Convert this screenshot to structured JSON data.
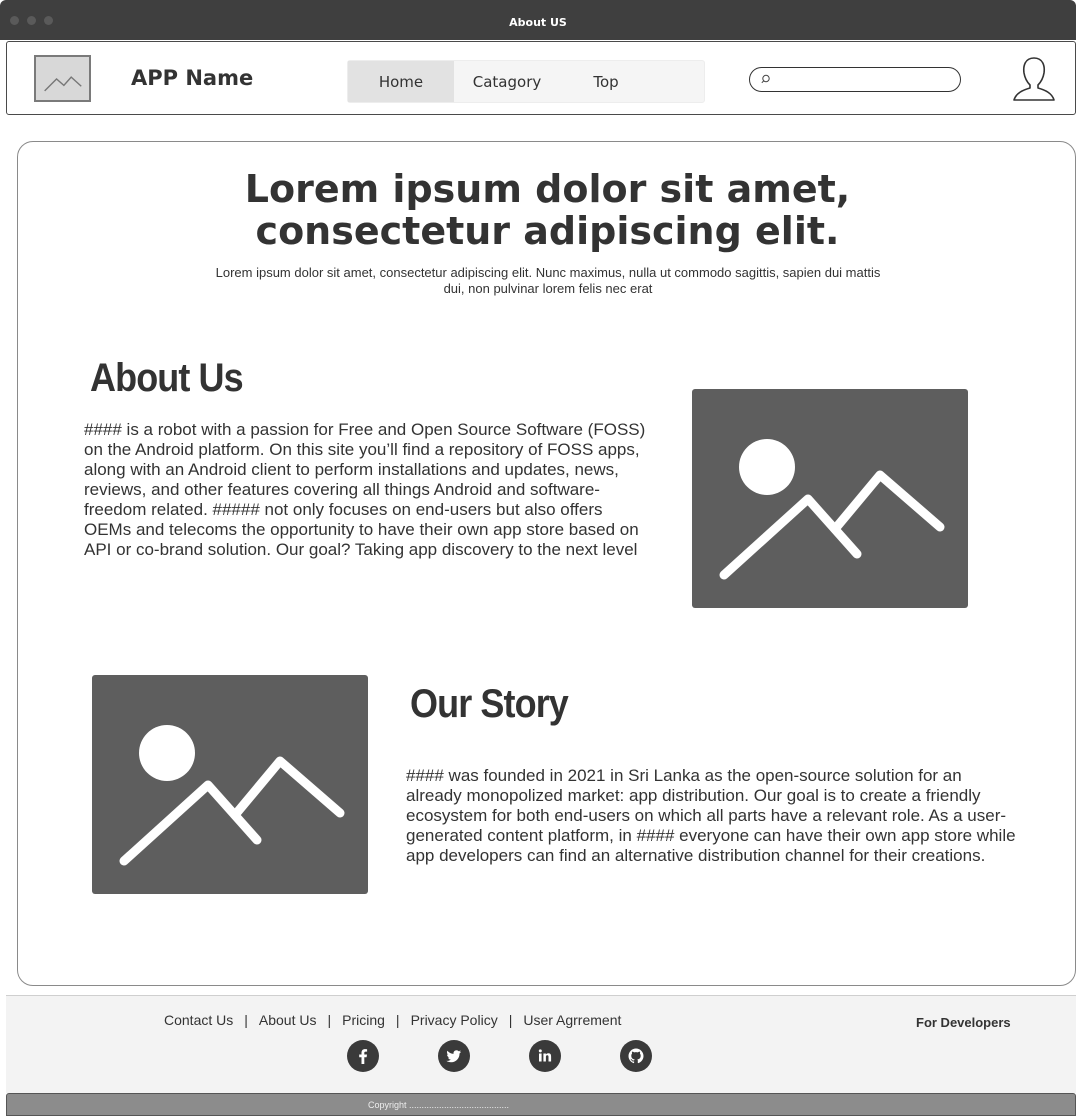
{
  "window": {
    "title": "About US"
  },
  "header": {
    "app_name": "APP Name",
    "nav": [
      {
        "label": "Home"
      },
      {
        "label": "Catagory"
      },
      {
        "label": "Top"
      }
    ],
    "search": {
      "placeholder": ""
    }
  },
  "hero": {
    "title_line1": "Lorem ipsum dolor sit amet,",
    "title_line2": "consectetur adipiscing elit.",
    "subtitle": "Lorem ipsum dolor sit amet, consectetur adipiscing elit. Nunc maximus, nulla ut commodo sagittis, sapien dui mattis dui, non pulvinar lorem felis nec erat"
  },
  "about": {
    "title": "About Us",
    "text": "#### is a robot with a passion for Free and Open Source Software (FOSS) on the Android platform. On this site you’ll find a repository of FOSS apps, along with an Android client to perform installations and updates, news, reviews, and other features covering all things Android and software-freedom related. ##### not only focuses on end-users but also offers OEMs and telecoms the opportunity to have their own app store based on API or co-brand solution. Our goal? Taking app discovery to the next level"
  },
  "story": {
    "title": "Our Story",
    "text": "#### was founded in 2021 in Sri Lanka as the open-source solution for an already monopolized market: app distribution. Our goal is to create a friendly ecosystem for both end-users on which all parts have a relevant role. As a user-generated content platform, in #### everyone can have their own app store while app developers can find an alternative distribution channel for their creations."
  },
  "footer": {
    "links": [
      "Contact Us",
      "About Us",
      "Pricing",
      "Privacy Policy",
      "User Agrrement"
    ],
    "separator": "|",
    "for_developers": "For Developers",
    "socials": [
      "facebook-icon",
      "twitter-icon",
      "linkedin-icon",
      "github-icon"
    ],
    "copyright": "Copyright ........................................"
  }
}
